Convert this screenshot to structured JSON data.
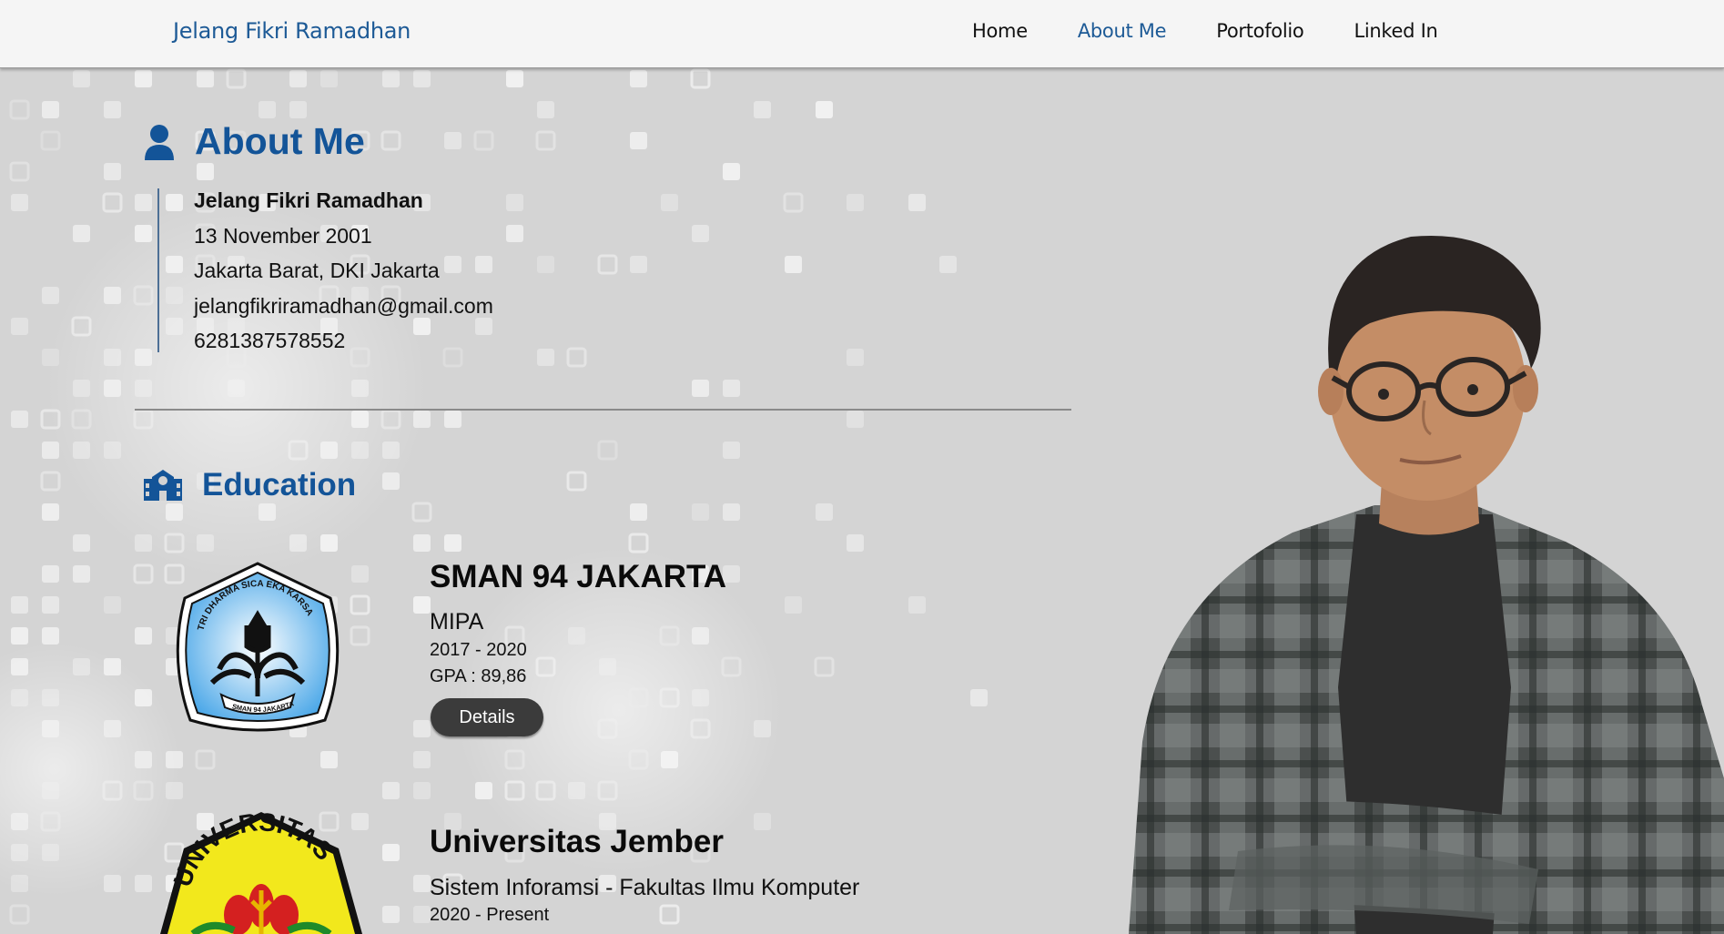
{
  "nav": {
    "brand": "Jelang Fikri Ramadhan",
    "links": [
      {
        "label": "Home",
        "active": false
      },
      {
        "label": "About Me",
        "active": true
      },
      {
        "label": "Portofolio",
        "active": false
      },
      {
        "label": "Linked In",
        "active": false
      }
    ]
  },
  "about": {
    "title": "About Me",
    "icon": "user-icon",
    "name": "Jelang Fikri Ramadhan",
    "birthdate": "13 November 2001",
    "location": "Jakarta Barat, DKI Jakarta",
    "email": "jelangfikriramadhan@gmail.com",
    "phone": "6281387578552"
  },
  "education": {
    "title": "Education",
    "icon": "school-icon",
    "entries": [
      {
        "school": "SMAN 94 JAKARTA",
        "major": "MIPA",
        "years": "2017 - 2020",
        "gpa": "GPA : 89,86",
        "button": "Details",
        "logo_text_top": "TRI DHARMA SICA EKA KARSA",
        "logo_text_bottom": "SMAN 94 JAKARTA"
      },
      {
        "school": "Universitas Jember",
        "major": "Sistem Inforamsi - Fakultas Ilmu Komputer",
        "years": "2020 - Present",
        "logo_text": "UNIVERSITAS"
      }
    ]
  },
  "colors": {
    "accent": "#135498",
    "brand": "#1d5a96",
    "background": "#d3d3d3",
    "navbar": "#f5f5f5",
    "button": "#3b3b3b"
  }
}
